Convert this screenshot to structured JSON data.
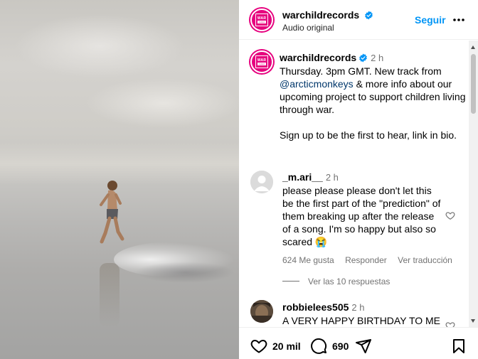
{
  "post": {
    "username": "warchildrecords",
    "subtitle": "Audio original",
    "follow_label": "Seguir",
    "logo_text_top": "WAR",
    "logo_text_bottom": "CHILD"
  },
  "caption": {
    "username": "warchildrecords",
    "time": "2 h",
    "line1": "Thursday. 3pm GMT. New track from",
    "mention": "@arcticmonkeys",
    "line2_rest": " & more info about our upcoming project to support children living through war.",
    "line3": "Sign up to be the first to hear, link in bio."
  },
  "comments": [
    {
      "username": "_m.ari__",
      "time": "2 h",
      "text": "please please please don't let this be the first part of the \"prediction\" of them breaking up after the release of a song. I'm so happy but also so scared 😭",
      "likes": "624 Me gusta",
      "reply": "Responder",
      "translate": "Ver traducción",
      "replies": "Ver las 10 respuestas"
    },
    {
      "username": "robbielees505",
      "time": "2 h",
      "text": "A VERY HAPPY BIRTHDAY TO ME"
    }
  ],
  "actions": {
    "likes": "20 mil",
    "comments": "690"
  },
  "colors": {
    "brand_pink": "#e6007e",
    "link_blue": "#0095f6",
    "mention_blue": "#00376b"
  }
}
